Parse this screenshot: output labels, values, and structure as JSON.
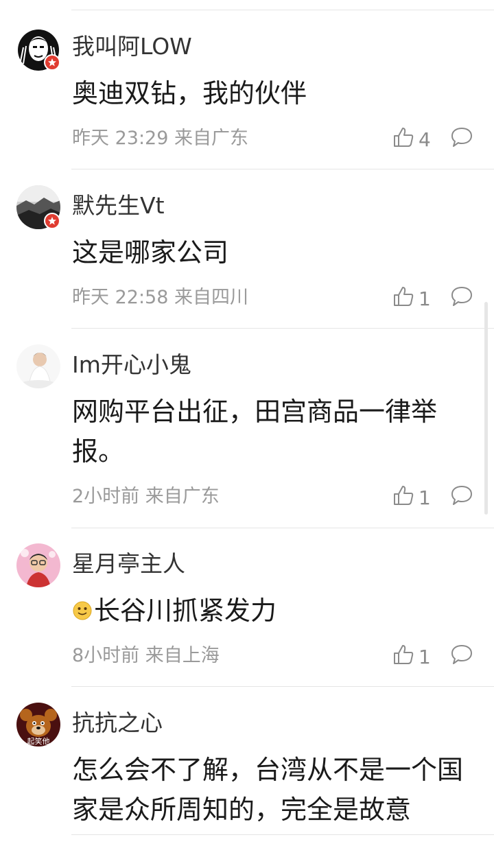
{
  "comments": [
    {
      "username": "我叫阿LOW",
      "content": "奥迪双钻，我的伙伴",
      "time": "昨天 23:29",
      "location": "来自广东",
      "likes": "4",
      "verified_badge": true
    },
    {
      "username": "默先生Vt",
      "content": "这是哪家公司",
      "time": "昨天 22:58",
      "location": "来自四川",
      "likes": "1",
      "verified_badge": true
    },
    {
      "username": "Im开心小鬼",
      "content": "网购平台出征，田宫商品一律举报。",
      "time": "2小时前",
      "location": "来自广东",
      "likes": "1",
      "verified_badge": false
    },
    {
      "username": "星月亭主人",
      "content": "长谷川抓紧发力",
      "content_emoji": "grinning-face-emoji",
      "time": "8小时前",
      "location": "来自上海",
      "likes": "1",
      "verified_badge": false
    },
    {
      "username": "抗抗之心",
      "content": "怎么会不了解，台湾从不是一个国家是众所周知的，完全是故意",
      "avatar_text": "起笑他",
      "time": "",
      "location": "",
      "likes": "",
      "verified_badge": false
    }
  ],
  "colors": {
    "text_primary": "#1a1a1a",
    "text_meta": "#9a9a9a",
    "badge": "#e03c31",
    "divider": "#e5e5e5"
  },
  "icons": {
    "like": "thumbs-up-icon",
    "reply": "speech-bubble-icon",
    "badge": "star-badge-icon"
  }
}
